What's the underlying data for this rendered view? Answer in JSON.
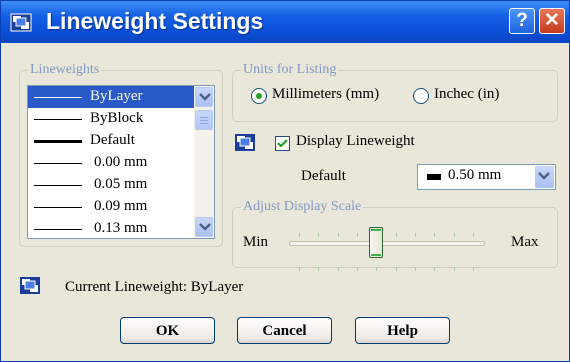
{
  "window": {
    "title": "Lineweight Settings",
    "icon": "lineweight-app-icon",
    "help_glyph": "?",
    "close_glyph": "✕"
  },
  "lineweights": {
    "legend": "Lineweights",
    "selected": "ByLayer",
    "items": [
      {
        "label": "ByLayer",
        "weight": 1
      },
      {
        "label": "ByBlock",
        "weight": 1
      },
      {
        "label": "Default",
        "weight": 3
      },
      {
        "label": "0.00 mm",
        "weight": 1
      },
      {
        "label": "0.05 mm",
        "weight": 1
      },
      {
        "label": "0.09 mm",
        "weight": 1
      },
      {
        "label": "0.13 mm",
        "weight": 1
      }
    ]
  },
  "units": {
    "legend": "Units for Listing",
    "mm_label": "Millimeters (mm)",
    "in_label": "Inchec (in)",
    "selected": "mm"
  },
  "display": {
    "checkbox_label": "Display Lineweight",
    "checked": true,
    "default_label": "Default",
    "default_value": "0.50 mm"
  },
  "scale": {
    "legend": "Adjust Display Scale",
    "min_label": "Min",
    "max_label": "Max",
    "tick_count": 10
  },
  "current": {
    "text": "Current Lineweight: ByLayer"
  },
  "buttons": {
    "ok": "OK",
    "cancel": "Cancel",
    "help": "Help"
  },
  "colors": {
    "titlebar": "#0b4fd6",
    "selection": "#2a5ac8",
    "legend_text": "#8497c6",
    "dialog_bg": "#e9e7da"
  }
}
